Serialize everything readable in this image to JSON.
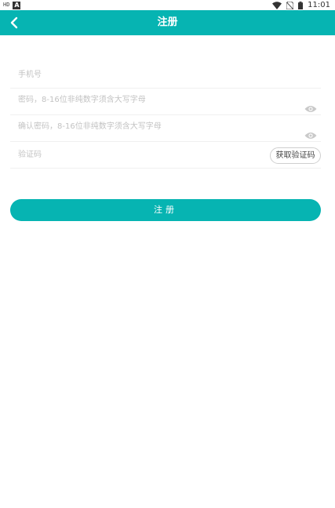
{
  "status_bar": {
    "left_indicator": "HD",
    "notification_badge": "A",
    "time": "11:01",
    "icons": [
      "wifi-icon",
      "no-sim-icon",
      "battery-icon"
    ]
  },
  "app_bar": {
    "title": "注册",
    "back_icon": "chevron-left-icon",
    "background": "#06b4b2"
  },
  "form": {
    "phone": {
      "placeholder": "手机号",
      "value": ""
    },
    "password": {
      "placeholder": "密码，8-16位非纯数字须含大写字母",
      "value": "",
      "toggle_icon": "eye-icon"
    },
    "confirm_password": {
      "placeholder": "确认密码，8-16位非纯数字须含大写字母",
      "value": "",
      "toggle_icon": "eye-icon"
    },
    "verification_code": {
      "placeholder": "验证码",
      "value": "",
      "button_label": "获取验证码"
    }
  },
  "register_button": {
    "label": "注册",
    "color": "#06b4b2"
  }
}
